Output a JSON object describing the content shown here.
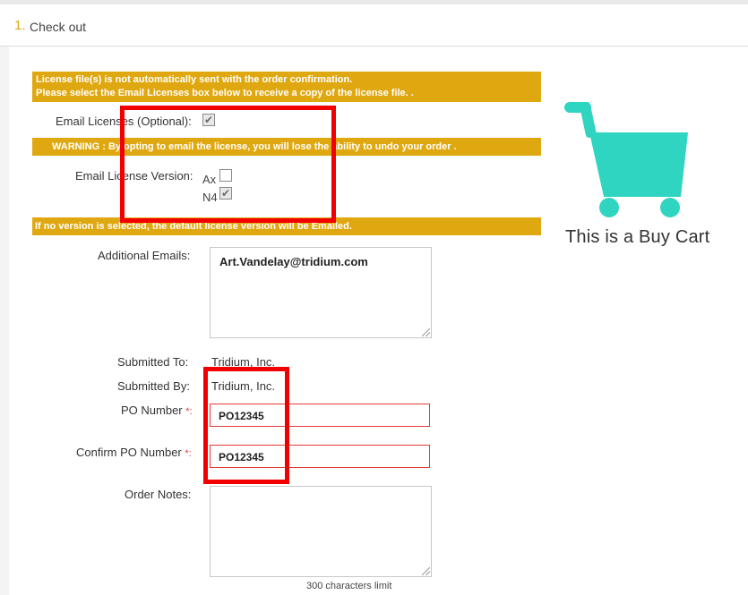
{
  "header": {
    "step_number": "1.",
    "title": "Check out"
  },
  "banners": {
    "license_line1": "License file(s) is not automatically sent with the order confirmation.",
    "license_line2": "Please select the Email Licenses box below to receive a copy of the license file. .",
    "warning": "WARNING : By opting to email the license, you will lose the ability to undo your order .",
    "default_version": "If no version is selected, the default license version will be Emailed."
  },
  "form": {
    "email_licenses_label": "Email Licenses (Optional):",
    "email_licenses_checked": true,
    "email_license_version_label": "Email License Version:",
    "versions": [
      {
        "label": "Ax",
        "checked": false
      },
      {
        "label": "N4",
        "checked": true
      }
    ],
    "additional_emails_label": "Additional Emails:",
    "additional_emails_value": "Art.Vandelay@tridium.com",
    "submitted_to_label": "Submitted To:",
    "submitted_to_value": "Tridium, Inc.",
    "submitted_by_label": "Submitted By:",
    "submitted_by_value": "Tridium, Inc.",
    "po_number_label": "PO Number",
    "po_number_value": "PO12345",
    "confirm_po_label": "Confirm PO Number",
    "confirm_po_value": "PO12345",
    "required_mark": "*:",
    "order_notes_label": "Order Notes:",
    "order_notes_value": "",
    "char_limit": "300 characters limit"
  },
  "cart": {
    "caption": "This is a Buy Cart",
    "icon": "shopping-cart-icon",
    "color": "#2fd5c0"
  },
  "annotations": {
    "highlight_color": "#f20000"
  }
}
